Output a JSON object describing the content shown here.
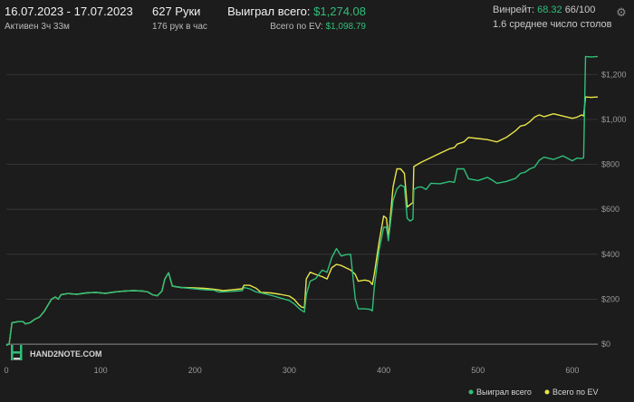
{
  "header": {
    "date_range": "16.07.2023 - 17.07.2023",
    "active_time": "Активен 3ч 33м",
    "hands": "627 Руки",
    "hands_per_hour": "176 рук в час",
    "won_label": "Выиграл всего:",
    "won_value": "$1,274.08",
    "ev_label": "Всего по EV:",
    "ev_value": "$1,098.79",
    "winrate_label": "Винрейт:",
    "winrate_value": "68.32",
    "winrate_rest": "66/100",
    "avg_tables": "1.6 среднее число столов"
  },
  "watermark": "HAND2NOTE.COM",
  "colors": {
    "won": "#2fbf7a",
    "ev": "#e7e54a",
    "grid": "#3a3a3a",
    "zero": "#8c8c8c"
  },
  "chart_data": {
    "type": "line",
    "x_ticks": [
      0,
      100,
      200,
      300,
      400,
      500,
      600
    ],
    "y_ticks": [
      0,
      200,
      400,
      600,
      800,
      1000,
      1200
    ],
    "y_tick_labels": [
      "$0",
      "$200",
      "$400",
      "$600",
      "$800",
      "$1,000",
      "$1,200"
    ],
    "xlim": [
      0,
      627
    ],
    "ylim": [
      -40,
      1330
    ],
    "legend_position": "bottom-right",
    "series": [
      {
        "name": "Выиграл всего",
        "color": "#2fbf7a",
        "points": [
          [
            0,
            -5
          ],
          [
            3,
            0
          ],
          [
            6,
            95
          ],
          [
            12,
            100
          ],
          [
            18,
            100
          ],
          [
            20,
            90
          ],
          [
            25,
            95
          ],
          [
            30,
            110
          ],
          [
            35,
            120
          ],
          [
            40,
            145
          ],
          [
            45,
            180
          ],
          [
            48,
            200
          ],
          [
            52,
            210
          ],
          [
            55,
            200
          ],
          [
            58,
            220
          ],
          [
            65,
            225
          ],
          [
            75,
            222
          ],
          [
            85,
            228
          ],
          [
            95,
            230
          ],
          [
            105,
            226
          ],
          [
            115,
            232
          ],
          [
            125,
            236
          ],
          [
            135,
            238
          ],
          [
            145,
            236
          ],
          [
            150,
            232
          ],
          [
            155,
            220
          ],
          [
            160,
            215
          ],
          [
            165,
            236
          ],
          [
            168,
            290
          ],
          [
            172,
            318
          ],
          [
            176,
            258
          ],
          [
            185,
            252
          ],
          [
            200,
            246
          ],
          [
            210,
            242
          ],
          [
            220,
            240
          ],
          [
            225,
            232
          ],
          [
            240,
            235
          ],
          [
            250,
            238
          ],
          [
            252,
            252
          ],
          [
            258,
            246
          ],
          [
            265,
            232
          ],
          [
            270,
            228
          ],
          [
            280,
            218
          ],
          [
            290,
            206
          ],
          [
            300,
            194
          ],
          [
            305,
            180
          ],
          [
            310,
            160
          ],
          [
            313,
            150
          ],
          [
            316,
            143
          ],
          [
            318,
            220
          ],
          [
            322,
            280
          ],
          [
            328,
            292
          ],
          [
            335,
            330
          ],
          [
            340,
            320
          ],
          [
            345,
            385
          ],
          [
            350,
            425
          ],
          [
            355,
            392
          ],
          [
            360,
            398
          ],
          [
            365,
            400
          ],
          [
            370,
            200
          ],
          [
            373,
            157
          ],
          [
            380,
            157
          ],
          [
            385,
            155
          ],
          [
            388,
            148
          ],
          [
            390,
            250
          ],
          [
            395,
            415
          ],
          [
            400,
            520
          ],
          [
            403,
            520
          ],
          [
            405,
            460
          ],
          [
            410,
            640
          ],
          [
            414,
            690
          ],
          [
            418,
            708
          ],
          [
            422,
            700
          ],
          [
            425,
            560
          ],
          [
            428,
            548
          ],
          [
            431,
            556
          ],
          [
            432,
            688
          ],
          [
            436,
            698
          ],
          [
            440,
            700
          ],
          [
            445,
            688
          ],
          [
            450,
            716
          ],
          [
            460,
            714
          ],
          [
            470,
            724
          ],
          [
            475,
            720
          ],
          [
            478,
            780
          ],
          [
            485,
            780
          ],
          [
            490,
            736
          ],
          [
            500,
            728
          ],
          [
            510,
            742
          ],
          [
            515,
            730
          ],
          [
            520,
            716
          ],
          [
            530,
            724
          ],
          [
            540,
            738
          ],
          [
            545,
            760
          ],
          [
            550,
            765
          ],
          [
            555,
            780
          ],
          [
            560,
            788
          ],
          [
            565,
            818
          ],
          [
            570,
            832
          ],
          [
            580,
            822
          ],
          [
            590,
            838
          ],
          [
            600,
            816
          ],
          [
            605,
            828
          ],
          [
            610,
            826
          ],
          [
            612,
            830
          ],
          [
            614,
            1280
          ],
          [
            620,
            1278
          ],
          [
            627,
            1280
          ]
        ]
      },
      {
        "name": "Всего по EV",
        "color": "#e7e54a",
        "points": [
          [
            0,
            -5
          ],
          [
            3,
            0
          ],
          [
            6,
            95
          ],
          [
            12,
            100
          ],
          [
            18,
            100
          ],
          [
            20,
            90
          ],
          [
            25,
            95
          ],
          [
            30,
            110
          ],
          [
            35,
            120
          ],
          [
            40,
            145
          ],
          [
            45,
            180
          ],
          [
            48,
            200
          ],
          [
            52,
            210
          ],
          [
            55,
            200
          ],
          [
            58,
            220
          ],
          [
            65,
            225
          ],
          [
            75,
            222
          ],
          [
            85,
            228
          ],
          [
            95,
            230
          ],
          [
            105,
            226
          ],
          [
            115,
            232
          ],
          [
            125,
            236
          ],
          [
            135,
            238
          ],
          [
            145,
            236
          ],
          [
            150,
            232
          ],
          [
            155,
            220
          ],
          [
            160,
            215
          ],
          [
            165,
            236
          ],
          [
            168,
            290
          ],
          [
            172,
            318
          ],
          [
            176,
            258
          ],
          [
            185,
            252
          ],
          [
            200,
            250
          ],
          [
            210,
            248
          ],
          [
            220,
            244
          ],
          [
            230,
            238
          ],
          [
            240,
            242
          ],
          [
            250,
            246
          ],
          [
            252,
            262
          ],
          [
            258,
            262
          ],
          [
            265,
            248
          ],
          [
            270,
            230
          ],
          [
            280,
            228
          ],
          [
            290,
            222
          ],
          [
            300,
            214
          ],
          [
            305,
            200
          ],
          [
            310,
            175
          ],
          [
            313,
            165
          ],
          [
            316,
            162
          ],
          [
            318,
            290
          ],
          [
            322,
            320
          ],
          [
            328,
            310
          ],
          [
            335,
            300
          ],
          [
            340,
            290
          ],
          [
            345,
            340
          ],
          [
            350,
            355
          ],
          [
            355,
            350
          ],
          [
            360,
            340
          ],
          [
            365,
            330
          ],
          [
            370,
            310
          ],
          [
            373,
            280
          ],
          [
            380,
            285
          ],
          [
            385,
            280
          ],
          [
            388,
            265
          ],
          [
            390,
            310
          ],
          [
            395,
            450
          ],
          [
            400,
            570
          ],
          [
            403,
            560
          ],
          [
            405,
            470
          ],
          [
            410,
            700
          ],
          [
            414,
            780
          ],
          [
            418,
            780
          ],
          [
            422,
            760
          ],
          [
            425,
            610
          ],
          [
            428,
            620
          ],
          [
            431,
            630
          ],
          [
            432,
            790
          ],
          [
            436,
            800
          ],
          [
            440,
            810
          ],
          [
            445,
            820
          ],
          [
            450,
            830
          ],
          [
            460,
            850
          ],
          [
            470,
            870
          ],
          [
            475,
            875
          ],
          [
            478,
            890
          ],
          [
            485,
            900
          ],
          [
            490,
            920
          ],
          [
            500,
            915
          ],
          [
            510,
            910
          ],
          [
            515,
            905
          ],
          [
            520,
            900
          ],
          [
            530,
            920
          ],
          [
            540,
            950
          ],
          [
            545,
            970
          ],
          [
            550,
            975
          ],
          [
            555,
            990
          ],
          [
            560,
            1010
          ],
          [
            565,
            1020
          ],
          [
            570,
            1012
          ],
          [
            580,
            1025
          ],
          [
            590,
            1015
          ],
          [
            600,
            1005
          ],
          [
            605,
            1010
          ],
          [
            610,
            1020
          ],
          [
            612,
            1015
          ],
          [
            614,
            1100
          ],
          [
            620,
            1098
          ],
          [
            627,
            1100
          ]
        ]
      }
    ]
  }
}
